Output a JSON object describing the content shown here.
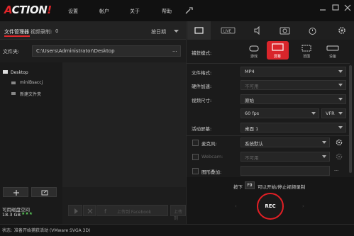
{
  "app": {
    "logo_main": "ACTION",
    "logo_bang": "!",
    "menu": [
      "设置",
      "帐户",
      "关于",
      "帮助"
    ]
  },
  "left": {
    "tab_file_manager": "文件管理器",
    "tab_video_recording": "视频录制:",
    "tab_count": "0",
    "sort_label": "按日期",
    "folder_label": "文件夹:",
    "folder_path": "C:\\Users\\Administrator\\Desktop",
    "folder_more": "...",
    "tree": [
      {
        "label": "Desktop",
        "icon": "monitor-icon"
      },
      {
        "label": "miniBsaccj",
        "icon": "folder-icon"
      },
      {
        "label": "新建文件夹",
        "icon": "folder-icon"
      }
    ],
    "disk_label": "可用磁盘空间",
    "disk_value": "18.3 GB",
    "disk_stars": "★★★",
    "upload_facebook": "上传到 Facebook",
    "upload_youtube": "上传到"
  },
  "right": {
    "capture_mode_label": "捕获模式:",
    "capture_modes": [
      "游戏",
      "屏幕",
      "范围",
      "设备"
    ],
    "file_format_label": "文件格式:",
    "file_format_value": "MP4",
    "hw_accel_label": "硬件加速:",
    "hw_accel_value": "不可用",
    "video_size_label": "视频尺寸:",
    "video_size_value": "原始",
    "fps_value": "60 fps",
    "vfr_value": "VFR",
    "active_screen_label": "活动屏幕:",
    "active_screen_value": "桌面 1",
    "mic_label": "麦克风:",
    "mic_value": "系统默认",
    "webcam_label": "Webcam:",
    "webcam_value": "不可用",
    "overlay_label": "图形叠加:",
    "hint_prefix": "按下",
    "hint_key": "F9",
    "hint_suffix": "可以开始/停止视频录制",
    "rec_label": "REC"
  },
  "status": {
    "prefix": "状态:",
    "text": "准备开始捕获活动 (VMware SVGA 3D)"
  },
  "colors": {
    "accent": "#e1262a",
    "bg": "#1c1c1c",
    "text": "#d4d4d4"
  }
}
